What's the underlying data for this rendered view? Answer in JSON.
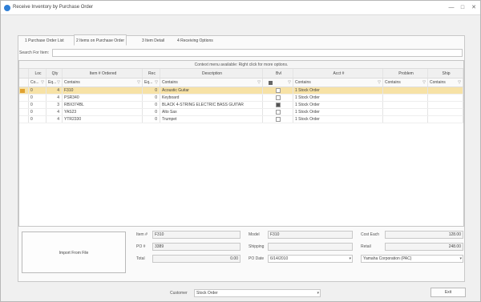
{
  "window": {
    "title": "Receive Inventory by Purchase Order",
    "minimize": "—",
    "maximize": "□",
    "close": "✕"
  },
  "tabs": [
    {
      "label": "1 Purchase Order List"
    },
    {
      "label": "2 Items on Purchase Order"
    },
    {
      "label": "3 Item Detail"
    },
    {
      "label": "4 Receiving Options"
    }
  ],
  "search": {
    "label": "Search For Item:",
    "value": ""
  },
  "grid": {
    "context_message": "Context menu available: Right click for more options.",
    "columns": [
      "Loc",
      "Qty",
      "Item # Ordered",
      "Rec",
      "Description",
      "Bvl",
      "Acct #",
      "Problem",
      "Ship"
    ],
    "filters": [
      "Co...",
      "Eq...",
      "Contains",
      "Eq...",
      "Contains",
      "",
      "Contains",
      "Contains",
      "Contains"
    ],
    "rows": [
      {
        "loc": "0",
        "qty": "4",
        "item": "F310",
        "rec": "0",
        "desc": "Acoustic Guitar",
        "bvl": false,
        "acct": "1 Stock Order",
        "selected": true
      },
      {
        "loc": "0",
        "qty": "4",
        "item": "PSR340",
        "rec": "0",
        "desc": "Keyboard",
        "bvl": false,
        "acct": "1 Stock Order",
        "selected": false
      },
      {
        "loc": "0",
        "qty": "3",
        "item": "RBX374BL",
        "rec": "0",
        "desc": "BLACK 4-STRING ELECTRIC BASS GUITAR",
        "bvl": true,
        "acct": "1 Stock Order",
        "selected": false
      },
      {
        "loc": "0",
        "qty": "4",
        "item": "YAS23",
        "rec": "0",
        "desc": "Alto Sax",
        "bvl": false,
        "acct": "1 Stock Order",
        "selected": false
      },
      {
        "loc": "0",
        "qty": "4",
        "item": "YTR2330",
        "rec": "0",
        "desc": "Trumpet",
        "bvl": false,
        "acct": "1 Stock Order",
        "selected": false
      }
    ]
  },
  "detail": {
    "import_button": "Import From File",
    "item_label": "Item #",
    "item_value": "F310",
    "po_label": "PO #",
    "po_value": "3389",
    "total_label": "Total",
    "total_value": "0.00",
    "model_label": "Model",
    "model_value": "F310",
    "shipping_label": "Shipping",
    "shipping_value": "",
    "podate_label": "PO Date",
    "podate_value": "6/14/2010",
    "costeach_label": "Cost Each",
    "costeach_value": "128.00",
    "retail_label": "Retail",
    "retail_value": "248.00",
    "vendor_value": "Yamaha Corporation (PAC)"
  },
  "footer": {
    "customer_label": "Customer",
    "customer_value": "Stock Order",
    "exit_label": "Exit"
  },
  "colors": {
    "selected_row": "#f7e2a6",
    "indicator": "#e0a232",
    "title_icon": "#2f7fd6"
  }
}
